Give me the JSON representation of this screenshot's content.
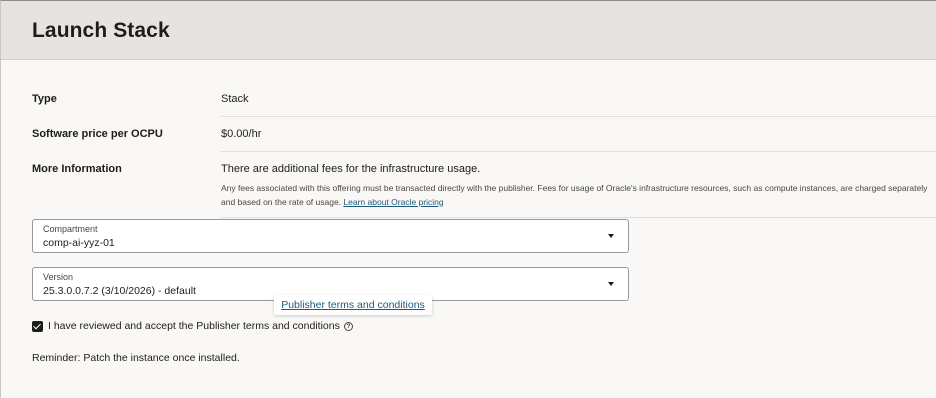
{
  "page": {
    "title": "Launch Stack"
  },
  "details": {
    "type_label": "Type",
    "type_value": "Stack",
    "price_label": "Software price per OCPU",
    "price_value": "$0.00/hr",
    "more_label": "More Information",
    "more_value": "There are additional fees for the infrastructure usage.",
    "more_detail": "Any fees associated with this offering must be transacted directly with the publisher. Fees for usage of Oracle's infrastructure resources, such as compute instances, are charged separately and based on the rate of usage.",
    "pricing_link": "Learn about Oracle pricing"
  },
  "compartment": {
    "label": "Compartment",
    "value": "comp-ai-yyz-01"
  },
  "version": {
    "label": "Version",
    "value": "25.3.0.0.7.2 (3/10/2026) - default"
  },
  "tooltip": {
    "link": "Publisher terms and conditions"
  },
  "terms": {
    "checked": true,
    "label": "I have reviewed and accept the Publisher terms and conditions",
    "help_icon": "?"
  },
  "reminder": "Reminder: Patch the instance once installed.",
  "colors": {
    "header_bg": "#e6e4e0",
    "page_bg": "#f9f8f6",
    "link": "#1e5a7a"
  }
}
